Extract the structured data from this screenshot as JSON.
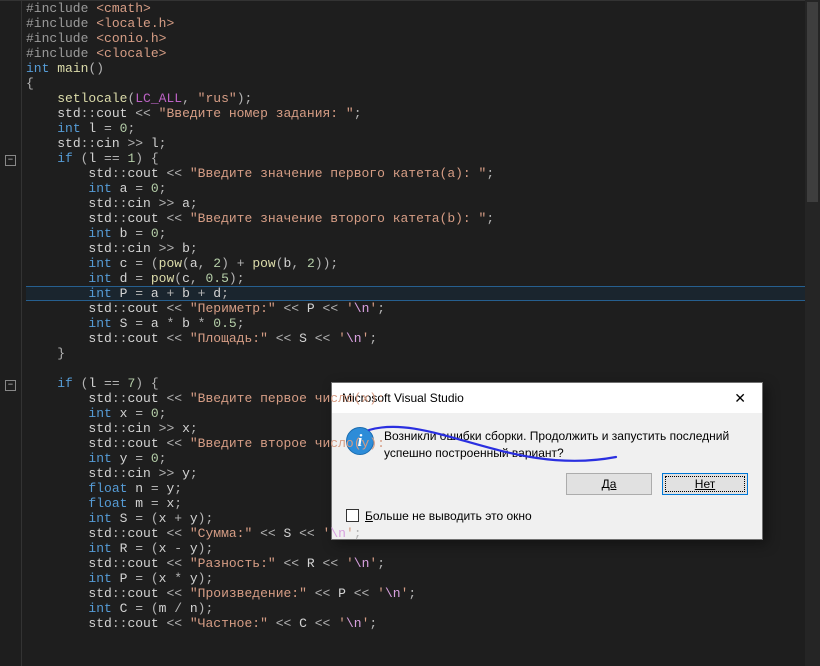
{
  "dialog": {
    "title": "Microsoft Visual Studio",
    "message_line1": "Возникли ошибки сборки. Продолжить и запустить последний",
    "message_line2": "успешно построенный вариант?",
    "yes_label": "Да",
    "no_label": "Нет",
    "checkbox_label_pre": "Б",
    "checkbox_label_rest": "ольше не выводить это окно"
  },
  "code": {
    "includes": [
      "cmath",
      "locale.h",
      "conio.h",
      "clocale"
    ],
    "main_sig": "int main()",
    "setlocale_arg1": "LC_ALL",
    "setlocale_arg2": "\"rus\"",
    "prompt_task": "\"Введите номер задания: \"",
    "var_l": "int l = 0;",
    "cin_l": "std::cin >> l;",
    "if1": "if (l == 1) {",
    "prompt_a": "\"Введите значение первого катета(a): \"",
    "var_a": "int a = 0;",
    "cin_a": "std::cin >> a;",
    "prompt_b": "\"Введите значение второго катета(b): \"",
    "var_b": "int b = 0;",
    "cin_b": "std::cin >> b;",
    "calc_c": "int c = (pow(a, 2) + pow(b, 2));",
    "calc_d": "int d = pow(c, 0.5);",
    "calc_P1": "int P = a + b + d;",
    "out_perim": "\"Периметр:\"",
    "calc_S1": "int S = a * b * 0.5;",
    "out_area": "\"Площадь:\"",
    "if7": "if (l == 7) {",
    "prompt_x": "\"Введите первое число(x): ",
    "var_x": "int x = 0;",
    "cin_x": "std::cin >> x;",
    "prompt_y": "\"Введите второе число(y): ",
    "var_y": "int y = 0;",
    "cin_y": "std::cin >> y;",
    "float_n": "float n = y;",
    "float_m": "float m = x;",
    "calc_S2": "int S = (x + y);",
    "out_sum": "\"Сумма:\"",
    "calc_R": "int R = (x - y);",
    "out_diff": "\"Разность:\"",
    "calc_P2": "int P = (x * y);",
    "out_prod": "\"Произведение:\"",
    "calc_C": "int C = (m / n);",
    "out_quot": "\"Частное:\""
  }
}
